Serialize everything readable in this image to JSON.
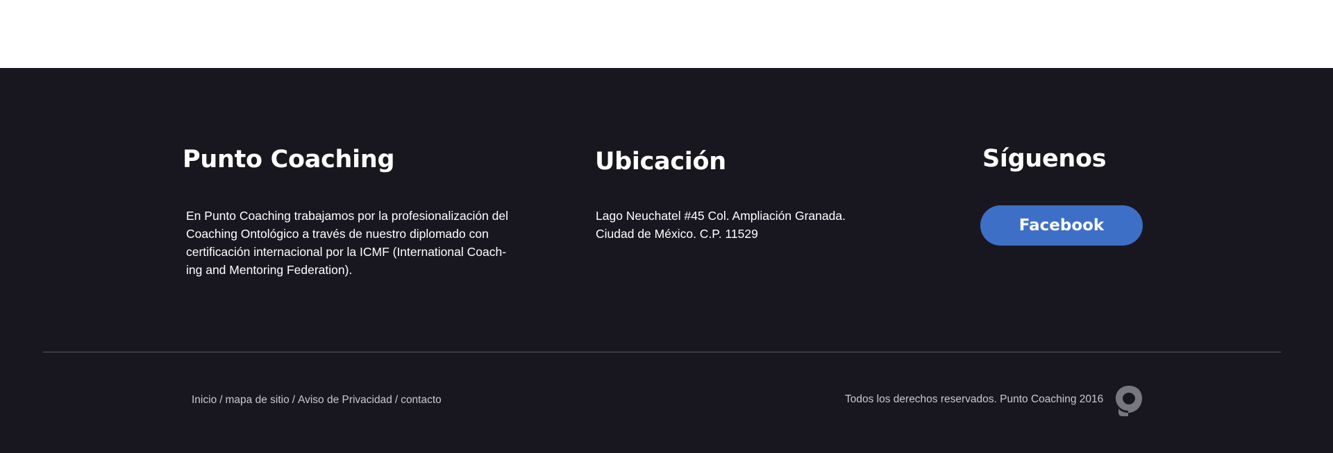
{
  "footer": {
    "about": {
      "title": "Punto Coaching",
      "lines": [
        "En Punto Coaching trabajamos por la profesionalización del",
        "Coaching Ontológico a través de nuestro diplomado con",
        "certificación internacional por la ICMF (International Coach-",
        "ing and Mentoring Federation)."
      ]
    },
    "location": {
      "title": "Ubicación",
      "lines": [
        "Lago Neuchatel #45 Col. Ampliación Granada.",
        "Ciudad de México. C.P. 11529"
      ]
    },
    "social": {
      "title": "Síguenos",
      "facebook_label": "Facebook"
    },
    "bottom": {
      "links": [
        "Inicio",
        "mapa de sitio",
        "Aviso de Privacidad",
        "contacto"
      ],
      "separator": "/",
      "copyright": "Todos los derechos reservados. Punto Coaching 2016",
      "logo_icon": "punto-coaching-logo-icon"
    },
    "colors": {
      "background": "#181720",
      "button": "#3e6fc7",
      "muted_text": "#c9c9d0",
      "logo": "#77777f"
    }
  }
}
